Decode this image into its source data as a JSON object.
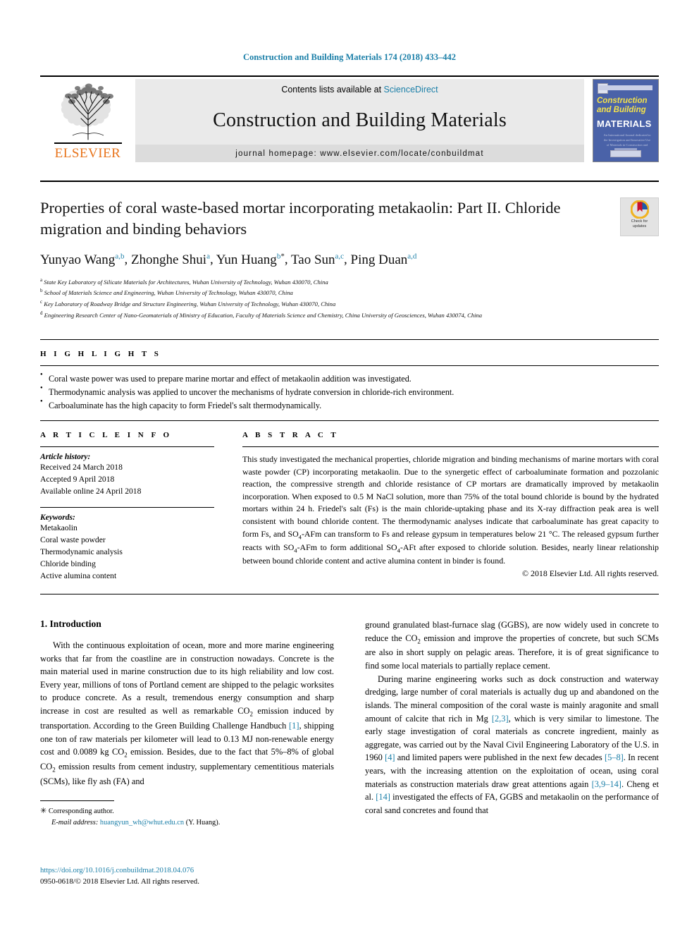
{
  "running_head": "Construction and Building Materials 174 (2018) 433–442",
  "masthead": {
    "contents_prefix": "Contents lists available at ",
    "sciencedirect": "ScienceDirect",
    "journal_title": "Construction and Building Materials",
    "homepage": "journal homepage: www.elsevier.com/locate/conbuildmat",
    "publisher": "ELSEVIER",
    "cover": {
      "line1": "Construction",
      "line2": "and Building",
      "line3": "MATERIALS",
      "blurb": "An International Journal dedicated to the Investigation and Innovative Use of Materials in Construction and Repair"
    },
    "accent_color": "#1b7fa8",
    "elsevier_orange": "#e8741c"
  },
  "title": "Properties of coral waste-based mortar incorporating metakaolin: Part II. Chloride migration and binding behaviors",
  "crossmark": {
    "line1": "Check for",
    "line2": "updates"
  },
  "authors": [
    {
      "name": "Yunyao Wang",
      "sup": "a,b",
      "sep": ", "
    },
    {
      "name": "Zhonghe Shui",
      "sup": "a",
      "sep": ", "
    },
    {
      "name": "Yun Huang",
      "sup": "b",
      "star": "*",
      "sep": ", "
    },
    {
      "name": "Tao Sun",
      "sup": "a,c",
      "sep": ", "
    },
    {
      "name": "Ping Duan",
      "sup": "a,d",
      "sep": ""
    }
  ],
  "affiliations": [
    {
      "label": "a",
      "text": "State Key Laboratory of Silicate Materials for Architectures, Wuhan University of Technology, Wuhan 430070, China"
    },
    {
      "label": "b",
      "text": "School of Materials Science and Engineering, Wuhan University of Technology, Wuhan 430070, China"
    },
    {
      "label": "c",
      "text": "Key Laboratory of Roadway Bridge and Structure Engineering, Wuhan University of Technology, Wuhan 430070, China"
    },
    {
      "label": "d",
      "text": "Engineering Research Center of Nano-Geomaterials of Ministry of Education, Faculty of Materials Science and Chemistry, China University of Geosciences, Wuhan 430074, China"
    }
  ],
  "highlights": {
    "heading": "H I G H L I G H T S",
    "items": [
      "Coral waste power was used to prepare marine mortar and effect of metakaolin addition was investigated.",
      "Thermodynamic analysis was applied to uncover the mechanisms of hydrate conversion in chloride-rich environment.",
      "Carboaluminate has the high capacity to form Friedel's salt thermodynamically."
    ]
  },
  "article_info": {
    "heading": "A R T I C L E    I N F O",
    "history_label": "Article history:",
    "history": [
      "Received 24 March 2018",
      "Accepted 9 April 2018",
      "Available online 24 April 2018"
    ],
    "keywords_label": "Keywords:",
    "keywords": [
      "Metakaolin",
      "Coral waste powder",
      "Thermodynamic analysis",
      "Chloride binding",
      "Active alumina content"
    ]
  },
  "abstract": {
    "heading": "A B S T R A C T",
    "paragraphs": [
      "This study investigated the mechanical properties, chloride migration and binding mechanisms of marine mortars with coral waste powder (CP) incorporating metakaolin. Due to the synergetic effect of carboaluminate formation and pozzolanic reaction, the compressive strength and chloride resistance of CP mortars are dramatically improved by metakaolin incorporation. When exposed to 0.5 M NaCl solution, more than 75% of the total bound chloride is bound by the hydrated mortars within 24 h. Friedel's salt (Fs) is the main chloride-uptaking phase and its X-ray diffraction peak area is well consistent with bound chloride content. The thermodynamic analyses indicate that carboaluminate has great capacity to form Fs, and SO4-AFm can transform to Fs and release gypsum in temperatures below 21 °C. The released gypsum further reacts with SO4-AFm to form additional SO4-AFt after exposed to chloride solution. Besides, nearly linear relationship between bound chloride content and active alumina content in binder is found."
    ],
    "copyright": "© 2018 Elsevier Ltd. All rights reserved."
  },
  "body": {
    "section_number_title": "1. Introduction",
    "left_column": [
      "With the continuous exploitation of ocean, more and more marine engineering works that far from the coastline are in construction nowadays. Concrete is the main material used in marine construction due to its high reliability and low cost. Every year, millions of tons of Portland cement are shipped to the pelagic worksites to produce concrete. As a result, tremendous energy consumption and sharp increase in cost are resulted as well as remarkable CO2 emission induced by transportation. According to the Green Building Challenge Handbuch [1], shipping one ton of raw materials per kilometer will lead to 0.13 MJ non-renewable energy cost and 0.0089 kg CO2 emission. Besides, due to the fact that 5%–8% of global CO2 emission results from cement industry, supplementary cementitious materials (SCMs), like fly ash (FA) and"
    ],
    "right_column": [
      "ground granulated blast-furnace slag (GGBS), are now widely used in concrete to reduce the CO2 emission and improve the properties of concrete, but such SCMs are also in short supply on pelagic areas. Therefore, it is of great significance to find some local materials to partially replace cement.",
      "During marine engineering works such as dock construction and waterway dredging, large number of coral materials is actually dug up and abandoned on the islands. The mineral composition of the coral waste is mainly aragonite and small amount of calcite that rich in Mg [2,3], which is very similar to limestone. The early stage investigation of coral materials as concrete ingredient, mainly as aggregate, was carried out by the Naval Civil Engineering Laboratory of the U.S. in 1960 [4] and limited papers were published in the next few decades [5–8]. In recent years, with the increasing attention on the exploitation of ocean, using coral materials as construction materials draw great attentions again [3,9–14]. Cheng et al. [14] investigated the effects of FA, GGBS and metakaolin on the performance of coral sand concretes and found that"
    ]
  },
  "footnote": {
    "corresponding_label": "Corresponding author.",
    "email_label": "E-mail address:",
    "email": "huangyun_wh@whut.edu.cn",
    "email_suffix": "(Y. Huang)."
  },
  "bottom": {
    "doi": "https://doi.org/10.1016/j.conbuildmat.2018.04.076",
    "issn_line": "0950-0618/© 2018 Elsevier Ltd. All rights reserved."
  }
}
